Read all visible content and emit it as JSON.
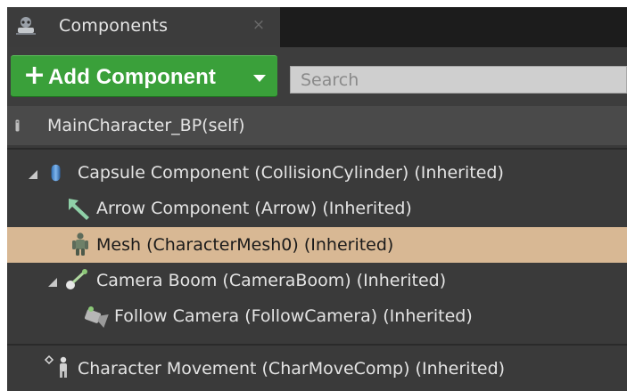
{
  "tab": {
    "title": "Components",
    "icon": "components-icon",
    "close": "×"
  },
  "toolbar": {
    "add_plus": "+",
    "add_label": "Add Component",
    "search_placeholder": "Search"
  },
  "self_row": {
    "label": "MainCharacter_BP(self)",
    "icon": "character-self-icon"
  },
  "tree": [
    {
      "label": "Capsule Component (CollisionCylinder) (Inherited)",
      "icon": "capsule-icon",
      "expanded": true,
      "selected": false
    },
    {
      "label": "Arrow Component (Arrow) (Inherited)",
      "icon": "arrow-icon",
      "selected": false
    },
    {
      "label": "Mesh (CharacterMesh0) (Inherited)",
      "icon": "skeletal-mesh-icon",
      "selected": true
    },
    {
      "label": "Camera Boom (CameraBoom) (Inherited)",
      "icon": "spring-arm-icon",
      "expanded": true,
      "selected": false
    },
    {
      "label": "Follow Camera (FollowCamera) (Inherited)",
      "icon": "camera-icon",
      "selected": false
    },
    {
      "label": "Character Movement (CharMoveComp) (Inherited)",
      "icon": "movement-icon",
      "selected": false
    }
  ],
  "colors": {
    "panel_bg": "#3a3a3a",
    "add_button": "#3aa03a",
    "selection": "#d8b894"
  }
}
